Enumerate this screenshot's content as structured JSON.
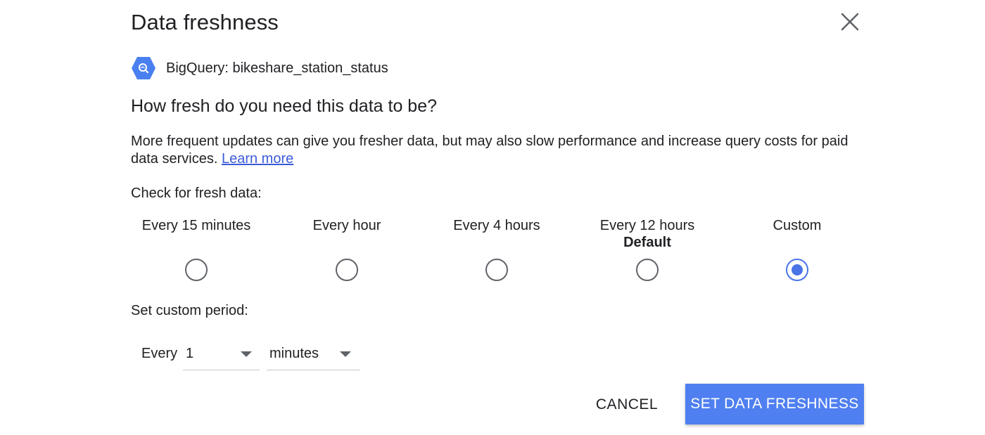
{
  "dialog": {
    "title": "Data freshness",
    "close_icon": "close-icon"
  },
  "source": {
    "icon": "bigquery-icon",
    "label": "BigQuery: bikeshare_station_status"
  },
  "question": "How fresh do you need this data to be?",
  "description": {
    "text": "More frequent updates can give you fresher data, but may also slow performance and increase query costs for paid data services. ",
    "link": "Learn more"
  },
  "check_label": "Check for fresh data:",
  "options": [
    {
      "label": "Every 15 minutes",
      "sub": "",
      "selected": false
    },
    {
      "label": "Every hour",
      "sub": "",
      "selected": false
    },
    {
      "label": "Every 4 hours",
      "sub": "",
      "selected": false
    },
    {
      "label": "Every 12 hours",
      "sub": "Default",
      "selected": false
    },
    {
      "label": "Custom",
      "sub": "",
      "selected": true
    }
  ],
  "custom": {
    "label": "Set custom period:",
    "every": "Every",
    "number": "1",
    "unit": "minutes"
  },
  "buttons": {
    "cancel": "CANCEL",
    "submit": "SET DATA FRESHNESS"
  },
  "colors": {
    "accent": "#4f7ff0",
    "radio_selected": "#4a73e8",
    "link": "#3c5bd8"
  }
}
